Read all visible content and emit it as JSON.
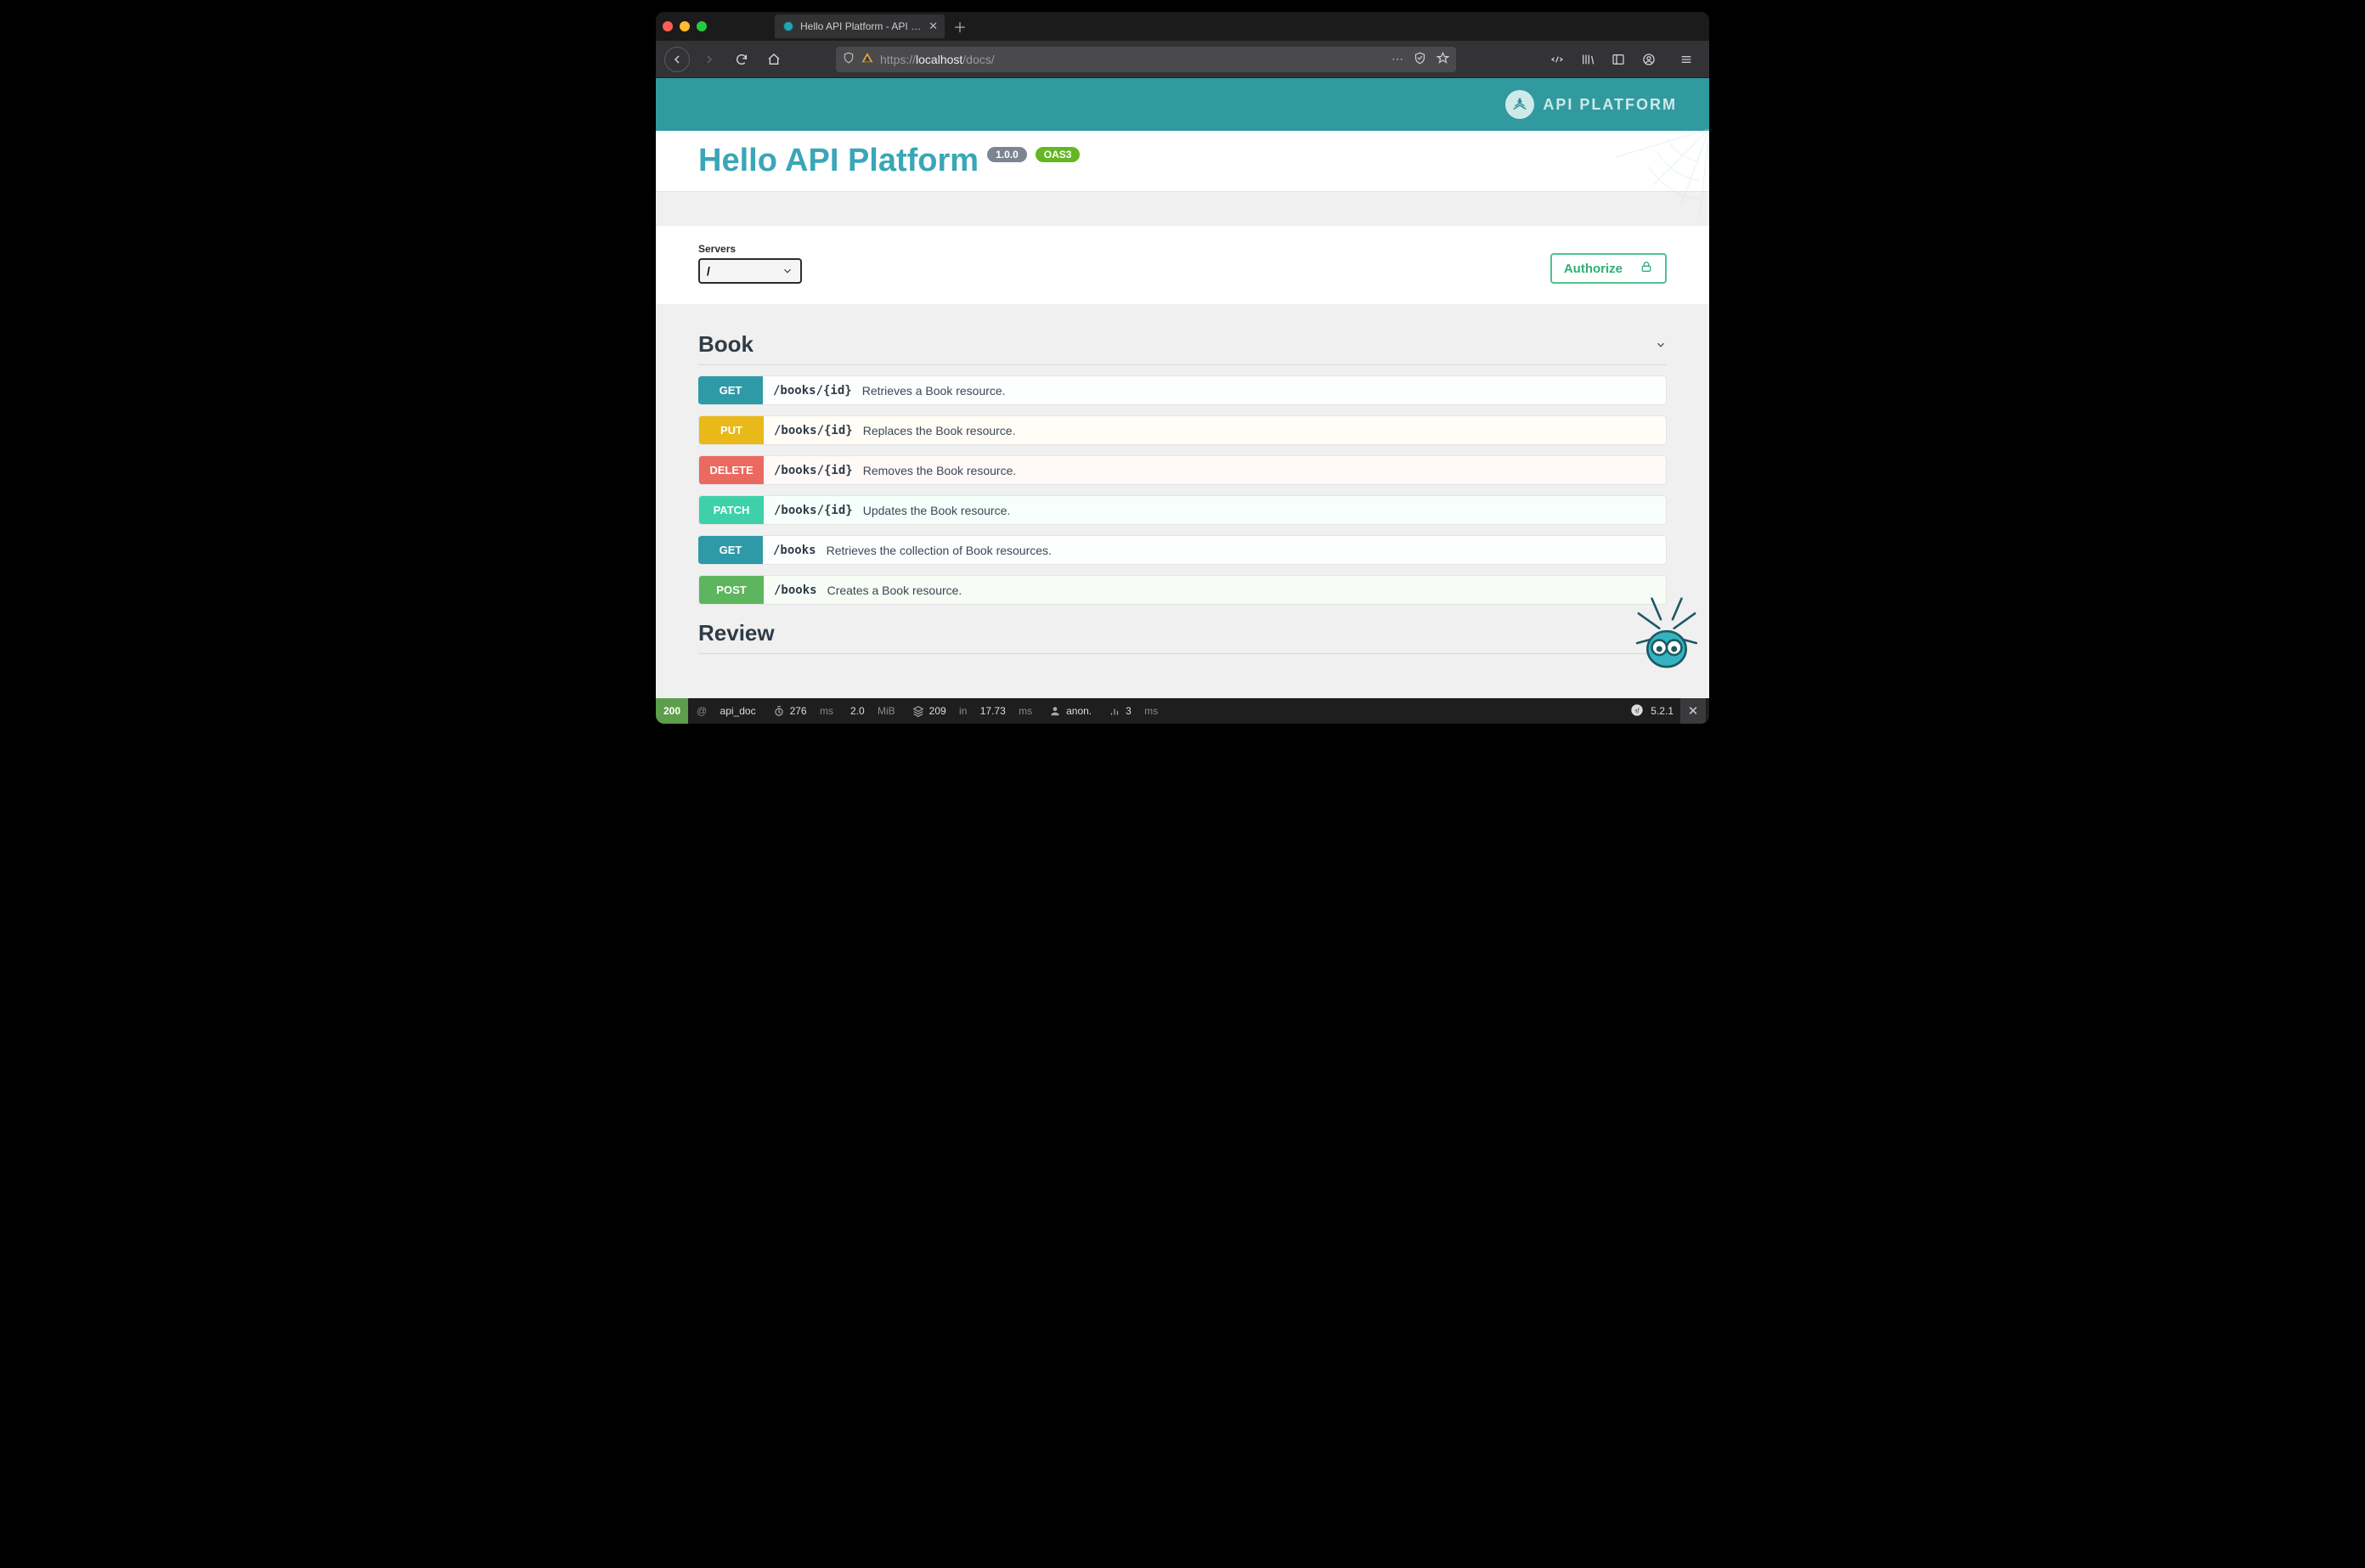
{
  "browser": {
    "tab_title": "Hello API Platform - API Platfor",
    "url_scheme": "https://",
    "url_host": "localhost",
    "url_path": "/docs/"
  },
  "brand": {
    "text": "API PLATFORM"
  },
  "title": {
    "heading": "Hello API Platform",
    "version": "1.0.0",
    "spec": "OAS3"
  },
  "servers": {
    "label": "Servers",
    "selected": "/"
  },
  "authorize": {
    "label": "Authorize"
  },
  "groups": [
    {
      "name": "Book",
      "ops": [
        {
          "method": "GET",
          "cls": "get",
          "mcls": "m-get",
          "path": "/books/{id}",
          "desc": "Retrieves a Book resource."
        },
        {
          "method": "PUT",
          "cls": "put",
          "mcls": "m-put",
          "path": "/books/{id}",
          "desc": "Replaces the Book resource."
        },
        {
          "method": "DELETE",
          "cls": "delete",
          "mcls": "m-del",
          "path": "/books/{id}",
          "desc": "Removes the Book resource."
        },
        {
          "method": "PATCH",
          "cls": "patch",
          "mcls": "m-patch",
          "path": "/books/{id}",
          "desc": "Updates the Book resource."
        },
        {
          "method": "GET",
          "cls": "get",
          "mcls": "m-get",
          "path": "/books",
          "desc": "Retrieves the collection of Book resources."
        },
        {
          "method": "POST",
          "cls": "post",
          "mcls": "m-post",
          "path": "/books",
          "desc": "Creates a Book resource."
        }
      ]
    },
    {
      "name": "Review",
      "ops": []
    }
  ],
  "debug": {
    "status": "200",
    "route_prefix": "@",
    "route": "api_doc",
    "time_ms": "276",
    "time_unit": "ms",
    "mem": "2.0",
    "mem_unit": "MiB",
    "db_count": "209",
    "db_in": "in",
    "db_ms": "17.73",
    "db_unit": "ms",
    "user": "anon.",
    "extra_ms": "3",
    "extra_unit": "ms",
    "sf_version": "5.2.1"
  }
}
